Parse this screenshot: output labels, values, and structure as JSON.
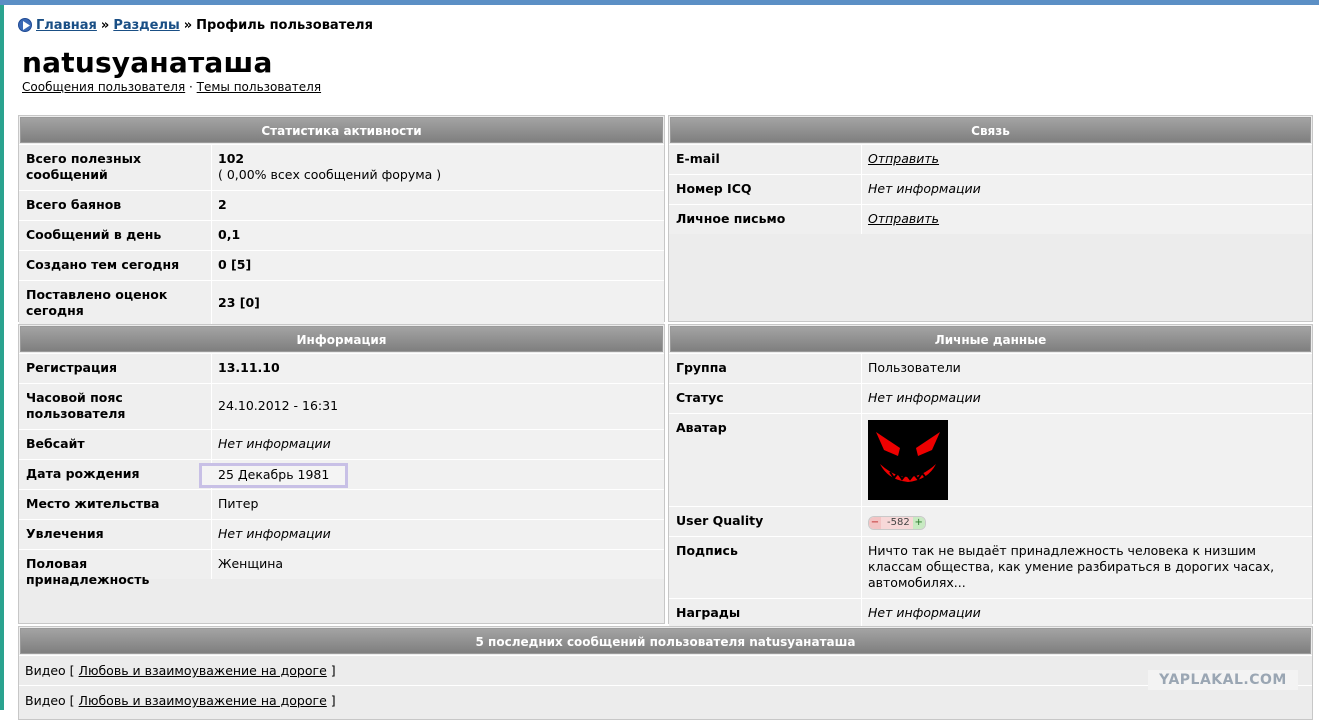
{
  "breadcrumb": {
    "home": "Главная",
    "sections": "Разделы",
    "current": "Профиль пользователя",
    "separator": "»"
  },
  "profile": {
    "username": "natusyанаташа",
    "link_posts": "Сообщения пользователя",
    "link_dot": "·",
    "link_topics": "Темы пользователя"
  },
  "stats": {
    "title": "Статистика активности",
    "rows": [
      {
        "label": "Всего полезных сообщений",
        "value": "102",
        "sub": "( 0,00% всех сообщений форума )"
      },
      {
        "label": "Всего баянов",
        "value": "2"
      },
      {
        "label": "Сообщений в день",
        "value": "0,1"
      },
      {
        "label": "Создано тем сегодня",
        "value": "0 [5]"
      },
      {
        "label": "Поставлено оценок сегодня",
        "value": "23 [0]"
      }
    ]
  },
  "contact": {
    "title": "Связь",
    "rows": [
      {
        "label": "E-mail",
        "value": "Отправить"
      },
      {
        "label": "Номер ICQ",
        "value": "Нет информации"
      },
      {
        "label": "Личное письмо",
        "value": "Отправить"
      }
    ]
  },
  "info": {
    "title": "Информация",
    "rows": [
      {
        "label": "Регистрация",
        "value": "13.11.10"
      },
      {
        "label": "Часовой пояс пользователя",
        "value": "24.10.2012 - 16:31"
      },
      {
        "label": "Вебсайт",
        "value": "Нет информации"
      },
      {
        "label": "Дата рождения",
        "value": "25 Декабрь 1981"
      },
      {
        "label": "Место жительства",
        "value": "Питер"
      },
      {
        "label": "Увлечения",
        "value": "Нет информации"
      },
      {
        "label": "Половая принадлежность",
        "value": "Женщина"
      }
    ]
  },
  "personal": {
    "title": "Личные данные",
    "rows": [
      {
        "label": "Группа",
        "value": "Пользователи"
      },
      {
        "label": "Статус",
        "value": "Нет информации"
      },
      {
        "label": "Аватар"
      },
      {
        "label": "User Quality",
        "minus": "−",
        "value": "-582",
        "plus": "+"
      },
      {
        "label": "Подпись",
        "value": "Ничто так не выдаёт принадлежность человека к низшим классам общества, как умение разбираться в дорогих часах, автомобилях..."
      },
      {
        "label": "Награды",
        "value": "Нет информации"
      }
    ]
  },
  "posts": {
    "title": "5 последних сообщений пользователя natusyанаташа",
    "items": [
      {
        "category": "Видео",
        "open": "[",
        "link": "Любовь и взаимоуважение на дороге",
        "close": "]"
      },
      {
        "category": "Видео",
        "open": "[",
        "link": "Любовь и взаимоуважение на дороге",
        "close": "]"
      }
    ]
  },
  "watermark": "YAPLAKAL.COM",
  "colors": {
    "accent_top": "#5b8fc5",
    "accent_left": "#2aa38f",
    "panel_header": "#8f8f8f",
    "link": "#1a4f85"
  }
}
